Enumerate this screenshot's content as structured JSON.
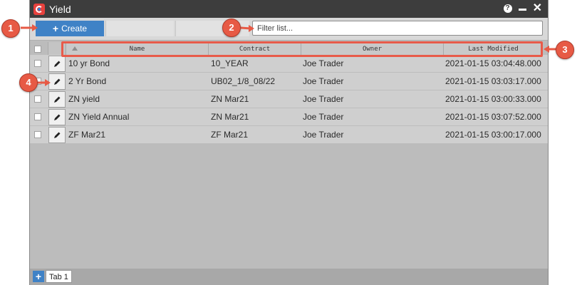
{
  "window": {
    "title": "Yield"
  },
  "toolbar": {
    "create_label": "Create"
  },
  "filter": {
    "placeholder": "Filter list..."
  },
  "table": {
    "columns": [
      "Name",
      "Contract",
      "Owner",
      "Last Modified"
    ],
    "rows": [
      {
        "name": "10 yr Bond",
        "contract": "10_YEAR",
        "owner": "Joe Trader",
        "modified": "2021-01-15 03:04:48.000"
      },
      {
        "name": "2 Yr Bond",
        "contract": "UB02_1/8_08/22",
        "owner": "Joe Trader",
        "modified": "2021-01-15 03:03:17.000"
      },
      {
        "name": "ZN yield",
        "contract": "ZN Mar21",
        "owner": "Joe Trader",
        "modified": "2021-01-15 03:00:33.000"
      },
      {
        "name": "ZN Yield Annual",
        "contract": "ZN Mar21",
        "owner": "Joe Trader",
        "modified": "2021-01-15 03:07:52.000"
      },
      {
        "name": "ZF Mar21",
        "contract": "ZF Mar21",
        "owner": "Joe Trader",
        "modified": "2021-01-15 03:00:17.000"
      }
    ]
  },
  "tabs": {
    "items": [
      "Tab 1"
    ]
  },
  "callouts": [
    "1",
    "2",
    "3",
    "4"
  ],
  "colors": {
    "accent": "#3f82c6",
    "callout": "#e75a45",
    "titlebar": "#3d3d3d"
  },
  "icons": [
    "app-logo-icon",
    "help-icon",
    "minimize-icon",
    "close-icon",
    "plus-icon",
    "pencil-icon",
    "sort-up-icon"
  ]
}
